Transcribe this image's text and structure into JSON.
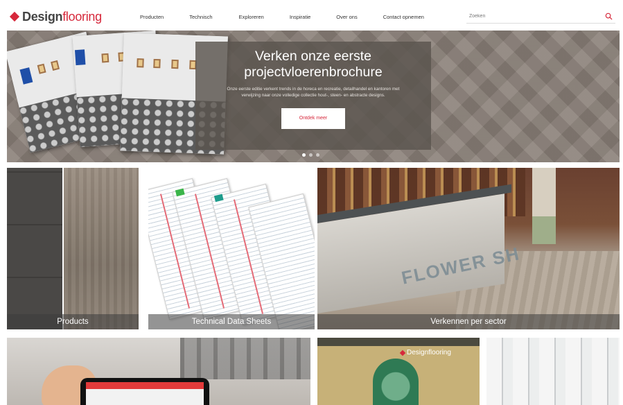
{
  "header": {
    "logo": {
      "part1": "Design",
      "part2": "flooring"
    },
    "nav": [
      {
        "label": "Producten",
        "name": "nav-producten"
      },
      {
        "label": "Technisch",
        "name": "nav-technisch"
      },
      {
        "label": "Exploreren",
        "name": "nav-exploreren"
      },
      {
        "label": "Inspiratie",
        "name": "nav-inspiratie"
      },
      {
        "label": "Over ons",
        "name": "nav-over-ons"
      },
      {
        "label": "Contact opnemen",
        "name": "nav-contact-opnemen"
      }
    ],
    "search": {
      "placeholder": "Zoeken",
      "icon": "search-icon"
    }
  },
  "hero": {
    "title": "Verken onze eerste projectvloerenbrochure",
    "text": "Onze eerste editie verkent trends in de horeca en recreatie, detailhandel en kantoren met verwijzing naar onze volledige collectie hout-, steen- en abstracte designs.",
    "button": "Ontdek meer",
    "slides": 3,
    "active_slide": 0
  },
  "tiles": [
    {
      "caption": "Products",
      "name": "tile-products"
    },
    {
      "caption": "Technical Data Sheets",
      "name": "tile-technical-data-sheets"
    },
    {
      "caption": "Verkennen per sector",
      "name": "tile-verkennen-per-sector"
    }
  ],
  "bar_graffiti": "FLOWER SH",
  "venue_logo": "Designflooring",
  "colors": {
    "accent": "#d6283b",
    "text": "#333333",
    "caption_bg": "rgba(60,60,60,0.55)"
  }
}
